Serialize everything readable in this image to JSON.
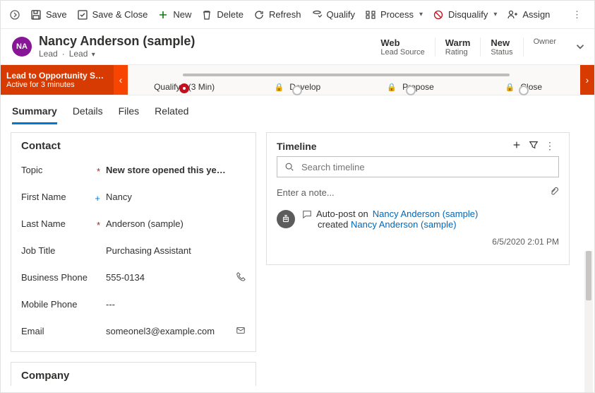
{
  "commandbar": {
    "save": "Save",
    "saveclose": "Save & Close",
    "new": "New",
    "delete": "Delete",
    "refresh": "Refresh",
    "qualify": "Qualify",
    "process": "Process",
    "disqualify": "Disqualify",
    "assign": "Assign"
  },
  "header": {
    "initials": "NA",
    "title": "Nancy Anderson (sample)",
    "entity": "Lead",
    "form": "Lead",
    "stats": [
      {
        "value": "Web",
        "label": "Lead Source"
      },
      {
        "value": "Warm",
        "label": "Rating"
      },
      {
        "value": "New",
        "label": "Status"
      },
      {
        "value": "",
        "label": "Owner"
      }
    ]
  },
  "bpf": {
    "name": "Lead to Opportunity Sale...",
    "duration": "Active for 3 minutes",
    "stages": {
      "qualify": "Qualify",
      "qualify_dur": "(3 Min)",
      "develop": "Develop",
      "propose": "Propose",
      "close": "Close"
    }
  },
  "tabs": {
    "summary": "Summary",
    "details": "Details",
    "files": "Files",
    "related": "Related"
  },
  "contact": {
    "section": "Contact",
    "topic_label": "Topic",
    "topic_value": "New store opened this year - f...",
    "firstname_label": "First Name",
    "firstname_value": "Nancy",
    "lastname_label": "Last Name",
    "lastname_value": "Anderson (sample)",
    "jobtitle_label": "Job Title",
    "jobtitle_value": "Purchasing Assistant",
    "busphone_label": "Business Phone",
    "busphone_value": "555-0134",
    "mobphone_label": "Mobile Phone",
    "mobphone_value": "---",
    "email_label": "Email",
    "email_value": "someonel3@example.com"
  },
  "company": {
    "section": "Company"
  },
  "timeline": {
    "title": "Timeline",
    "search_placeholder": "Search timeline",
    "note_placeholder": "Enter a note...",
    "post_title_prefix": "Auto-post on ",
    "post_title_link": "Nancy Anderson (sample)",
    "post_sub_prefix": "created ",
    "post_sub_link": "Nancy Anderson (sample)",
    "post_time": "6/5/2020 2:01 PM"
  }
}
